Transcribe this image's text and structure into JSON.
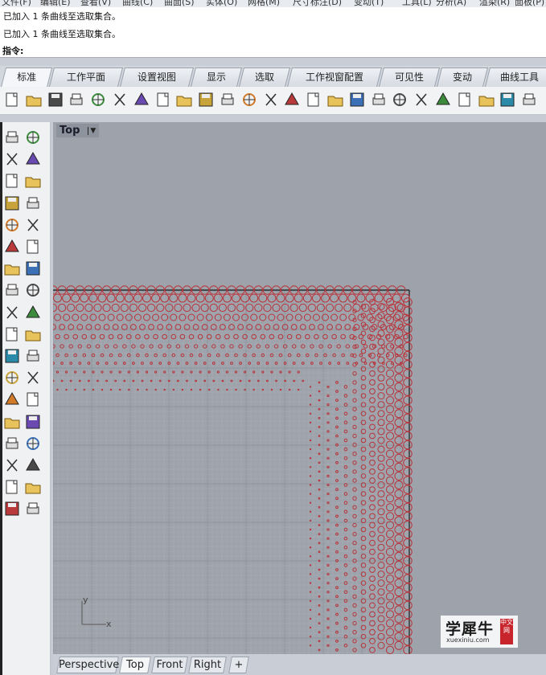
{
  "menubar": {
    "items": [
      "文件(F)",
      "编辑(E)",
      "查看(V)",
      "曲线(C)",
      "曲面(S)",
      "实体(O)",
      "网格(M)",
      "尺寸标注(D)",
      "变动(T)",
      "工具(L)",
      "分析(A)",
      "渲染(R)",
      "面板(P)"
    ]
  },
  "command_history": {
    "lines": [
      "已加入 1 条曲线至选取集合。",
      "已加入 1 条曲线至选取集合。"
    ]
  },
  "command_prompt": {
    "label": "指令:"
  },
  "tabs": [
    {
      "label": "标准",
      "active": true
    },
    {
      "label": "工作平面",
      "active": false
    },
    {
      "label": "设置视图",
      "active": false
    },
    {
      "label": "显示",
      "active": false
    },
    {
      "label": "选取",
      "active": false
    },
    {
      "label": "工作视窗配置",
      "active": false
    },
    {
      "label": "可见性",
      "active": false
    },
    {
      "label": "变动",
      "active": false
    },
    {
      "label": "曲线工具",
      "active": false
    }
  ],
  "toolbar_icons": [
    "new-icon",
    "open-icon",
    "save-icon",
    "print-icon",
    "import-icon",
    "cut-icon",
    "copy-icon",
    "paste-icon",
    "undo-icon",
    "pan-hand-icon",
    "rotate-view-icon",
    "zoom-icon",
    "zoom-window-icon",
    "zoom-extents-icon",
    "zoom-selected-icon",
    "rotate-icon",
    "four-viewports-icon",
    "car-render-icon",
    "hide-icon",
    "ghost-icon",
    "lights-icon",
    "bulb-icon",
    "lock-icon",
    "material-icon",
    "color-wheel-icon"
  ],
  "left_icons": [
    "select-arrow-icon",
    "point-icon",
    "polyline-icon",
    "curve-cv-icon",
    "circle-icon",
    "ellipse-icon",
    "arc-icon",
    "rectangle-icon",
    "polygon-icon",
    "fillet-curve-icon",
    "surface-corner-icon",
    "surface-loft-icon",
    "box-icon",
    "sphere-icon",
    "cylinder-icon",
    "extrude-icon",
    "split-icon",
    "explode-icon",
    "trim-icon",
    "boolean-icon",
    "point-cloud-icon",
    "points-icon",
    "curve-from-object-icon",
    "offset-icon",
    "text-icon",
    "scale-icon",
    "group-icon",
    "array-icon",
    "block-icon",
    "dimension-icon",
    "grid-points-icon",
    "layer-icon",
    "mesh-icon",
    "check-icon",
    "render-preview-icon",
    "analyze-icon"
  ],
  "viewport": {
    "name": "Top",
    "axis_y": "y",
    "axis_x": "x"
  },
  "bottom_tabs": [
    {
      "label": "Perspective",
      "active": false
    },
    {
      "label": "Top",
      "active": true
    },
    {
      "label": "Front",
      "active": false
    },
    {
      "label": "Right",
      "active": false
    }
  ],
  "add_tab": "+",
  "watermark": {
    "brand": "学犀牛",
    "url": "xuexiniu.com",
    "badge": "中文网"
  },
  "colors": {
    "circle_stroke": "#b8333a",
    "grid_line": "#a9afb7",
    "viewport_bg": "#9ea3ab",
    "border_line": "#1a1a1a"
  }
}
